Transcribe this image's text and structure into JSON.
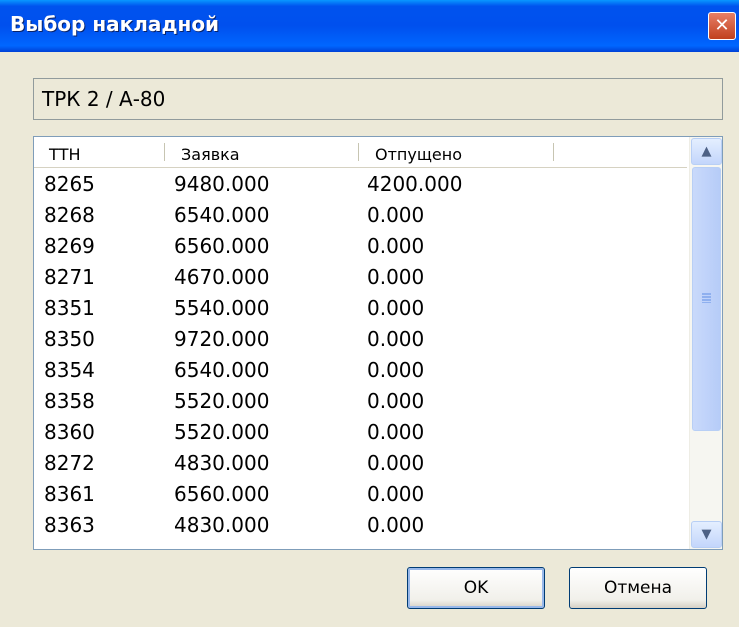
{
  "window": {
    "title": "Выбор накладной",
    "close_glyph": "✕"
  },
  "pump_label": "ТРК 2 / А-80",
  "table": {
    "columns": [
      "ТТН",
      "Заявка",
      "Отпущено"
    ],
    "rows": [
      [
        "8265",
        "9480.000",
        "4200.000"
      ],
      [
        "8268",
        "6540.000",
        "0.000"
      ],
      [
        "8269",
        "6560.000",
        "0.000"
      ],
      [
        "8271",
        "4670.000",
        "0.000"
      ],
      [
        "8351",
        "5540.000",
        "0.000"
      ],
      [
        "8350",
        "9720.000",
        "0.000"
      ],
      [
        "8354",
        "6540.000",
        "0.000"
      ],
      [
        "8358",
        "5520.000",
        "0.000"
      ],
      [
        "8360",
        "5520.000",
        "0.000"
      ],
      [
        "8272",
        "4830.000",
        "0.000"
      ],
      [
        "8361",
        "6560.000",
        "0.000"
      ],
      [
        "8363",
        "4830.000",
        "0.000"
      ]
    ]
  },
  "scrollbar": {
    "up_glyph": "▲",
    "down_glyph": "▼"
  },
  "buttons": {
    "ok": "OK",
    "cancel": "Отмена"
  }
}
